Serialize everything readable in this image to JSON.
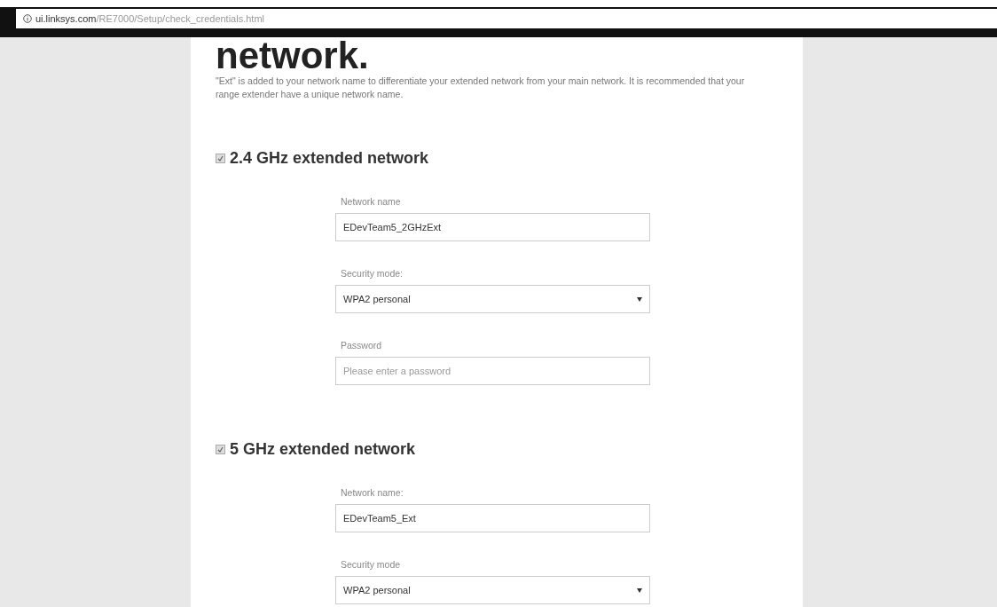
{
  "address_bar": {
    "domain": "ui.linksys.com",
    "path": "/RE7000/Setup/check_credentials.html"
  },
  "heading": "network.",
  "intro": "\"Ext\" is added to your network name to differentiate your extended network from your main network. It is recommended that your range extender have a unique network name.",
  "sections": [
    {
      "title": "2.4 GHz extended network",
      "checked": true,
      "fields": [
        {
          "kind": "text",
          "label": "Network name",
          "value": "EDevTeam5_2GHzExt"
        },
        {
          "kind": "select",
          "label": "Security mode:",
          "value": "WPA2 personal"
        },
        {
          "kind": "text",
          "label": "Password",
          "placeholder": "Please enter a password"
        }
      ]
    },
    {
      "title": "5 GHz extended network",
      "checked": true,
      "fields": [
        {
          "kind": "text",
          "label": "Network name:",
          "value": "EDevTeam5_Ext"
        },
        {
          "kind": "select",
          "label": "Security mode",
          "value": "WPA2 personal"
        }
      ]
    }
  ]
}
